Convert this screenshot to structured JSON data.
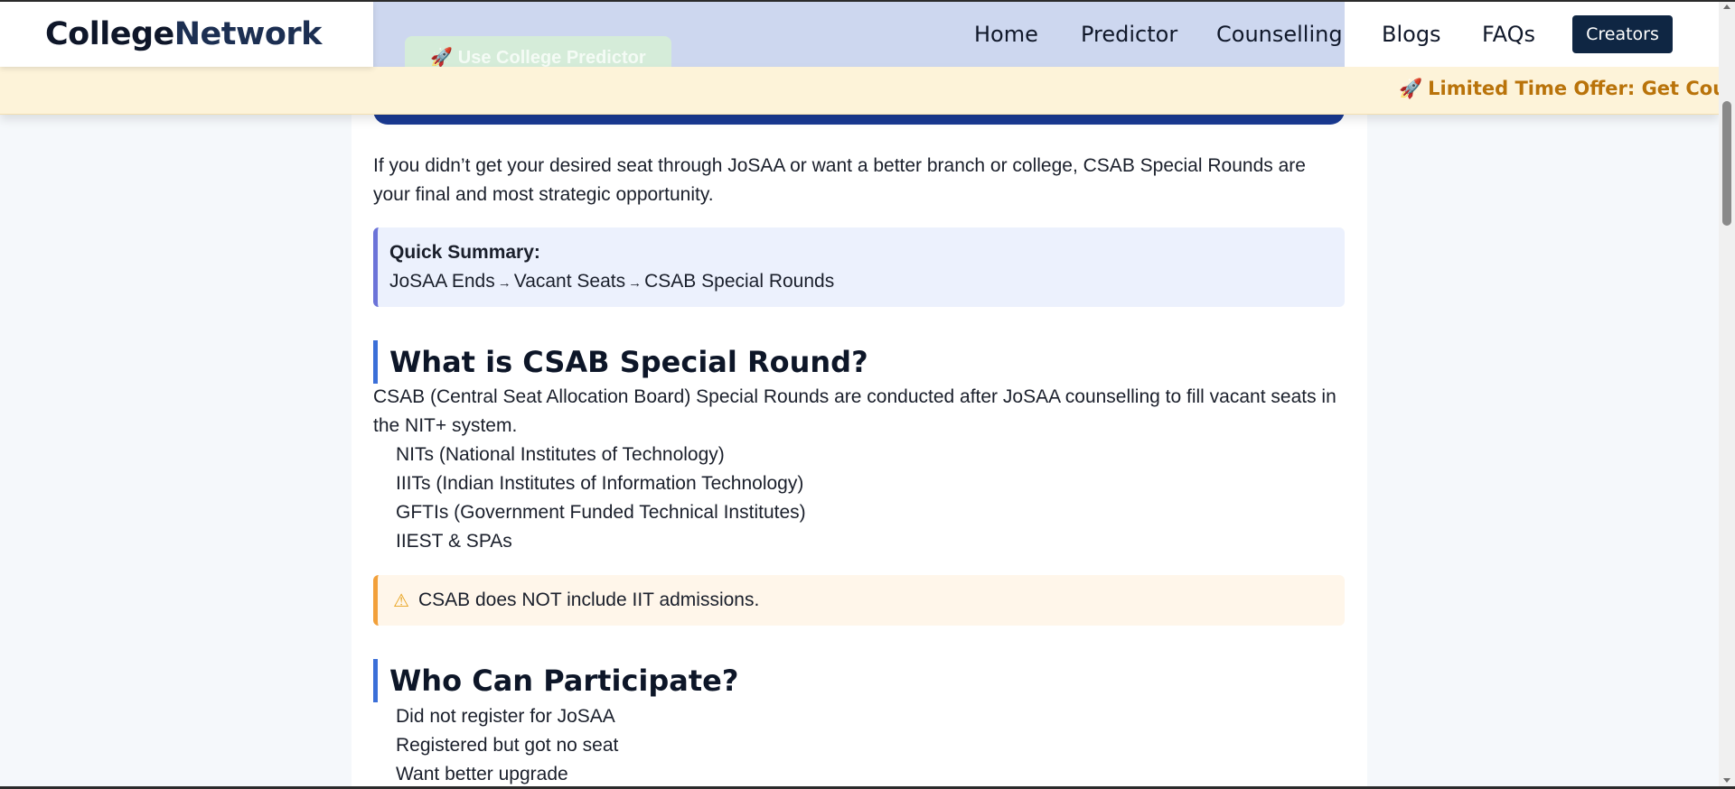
{
  "brand": {
    "part1": "College",
    "part2": "Network"
  },
  "nav": {
    "home": "Home",
    "predictor": "Predictor",
    "counselling": "Counselling",
    "blogs": "Blogs",
    "faqs": "FAQs",
    "creators": "Creators"
  },
  "hero": {
    "button_label": "🚀 Use College Predictor"
  },
  "offer": {
    "icon": "rocket-icon",
    "text": "Limited Time Offer: Get Counsel"
  },
  "article": {
    "intro": "If you didn’t get your desired seat through JoSAA or want a better branch or college, CSAB Special Rounds are your final and most strategic opportunity.",
    "summary": {
      "title": "Quick Summary:",
      "steps": [
        "JoSAA Ends",
        "Vacant Seats",
        "CSAB Special Rounds"
      ],
      "arrow": "→"
    },
    "section1": {
      "heading": "What is CSAB Special Round?",
      "text": "CSAB (Central Seat Allocation Board) Special Rounds are conducted after JoSAA counselling to fill vacant seats in the NIT+ system.",
      "items": [
        "NITs (National Institutes of Technology)",
        "IIITs (Indian Institutes of Information Technology)",
        "GFTIs (Government Funded Technical Institutes)",
        "IIEST & SPAs"
      ],
      "warning": "CSAB does NOT include IIT admissions."
    },
    "section2": {
      "heading": "Who Can Participate?",
      "items": [
        "Did not register for JoSAA",
        "Registered but got no seat",
        "Want better upgrade"
      ]
    }
  },
  "colors": {
    "accent_blue": "#3b6fd8",
    "summary_border": "#6b73d8",
    "warning_border": "#f2a03a",
    "offer_text": "#b9730a",
    "creators_bg": "#0f2643"
  }
}
